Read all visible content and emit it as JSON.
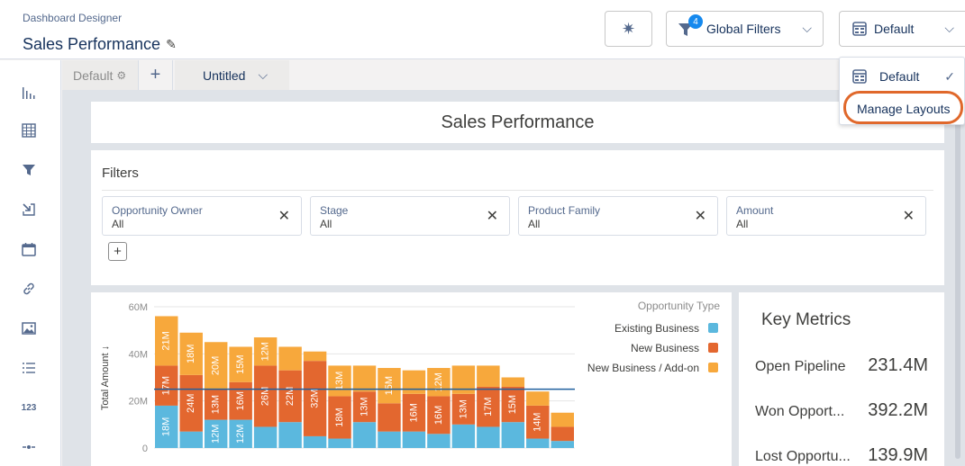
{
  "header": {
    "subtitle": "Dashboard Designer",
    "title": "Sales Performance",
    "filters_label": "Global Filters",
    "filters_count": "4",
    "layout_label": "Default"
  },
  "layout_menu": {
    "items": [
      {
        "label": "Default",
        "selected": true
      },
      {
        "label": "Manage Layouts",
        "selected": false
      }
    ],
    "highlight_color": "#e0682b"
  },
  "tabs": {
    "default_label": "Default",
    "untitled_label": "Untitled"
  },
  "toolbar_icons": [
    "chart-icon",
    "table-icon",
    "filter-icon",
    "compare-icon",
    "calendar-icon",
    "link-icon",
    "image-icon",
    "list-icon",
    "number-icon",
    "divider-icon"
  ],
  "toolbar_labels": {
    "number": "123"
  },
  "dashboard": {
    "title": "Sales Performance",
    "filters_heading": "Filters",
    "filters": [
      {
        "label": "Opportunity Owner",
        "value": "All"
      },
      {
        "label": "Stage",
        "value": "All"
      },
      {
        "label": "Product Family",
        "value": "All"
      },
      {
        "label": "Amount",
        "value": "All"
      }
    ]
  },
  "key_metrics": {
    "title": "Key Metrics",
    "rows": [
      {
        "label": "Open Pipeline",
        "value": "231.4M"
      },
      {
        "label": "Won Opport...",
        "value": "392.2M"
      },
      {
        "label": "Lost Opportu...",
        "value": "139.9M"
      }
    ]
  },
  "chart_data": {
    "type": "bar",
    "stacked": true,
    "ylabel": "Total Amount ↓",
    "ylim": [
      0,
      60
    ],
    "yticks": [
      "0",
      "20M",
      "40M",
      "60M"
    ],
    "legend_title": "Opportunity Type",
    "legend_position": "top-right",
    "series": [
      {
        "name": "Existing Business",
        "color": "#5bb8de",
        "values": [
          18,
          7,
          12,
          12,
          9,
          11,
          5,
          4,
          11,
          7,
          7,
          6,
          10,
          9,
          11,
          4,
          3
        ],
        "labels": [
          "18M",
          "",
          "12M",
          "12M",
          "",
          "",
          "",
          "",
          "",
          "",
          "",
          "",
          "",
          "",
          "",
          "",
          ""
        ]
      },
      {
        "name": "New Business",
        "color": "#e3672f",
        "values": [
          17,
          24,
          13,
          16,
          26,
          22,
          32,
          18,
          13,
          12,
          16,
          16,
          13,
          17,
          15,
          14,
          6
        ],
        "labels": [
          "17M",
          "24M",
          "13M",
          "16M",
          "26M",
          "22M",
          "32M",
          "18M",
          "13M",
          "",
          "16M",
          "16M",
          "13M",
          "17M",
          "15M",
          "14M",
          ""
        ]
      },
      {
        "name": "New Business / Add-on",
        "color": "#f7a83c",
        "values": [
          21,
          18,
          20,
          15,
          12,
          10,
          4,
          13,
          11,
          15,
          10,
          12,
          12,
          9,
          4,
          6,
          6
        ],
        "labels": [
          "21M",
          "18M",
          "20M",
          "15M",
          "12M",
          "",
          "",
          "13M",
          "",
          "15M",
          "",
          "12M",
          "",
          "",
          "",
          "",
          ""
        ]
      }
    ],
    "reference_line": 25
  }
}
